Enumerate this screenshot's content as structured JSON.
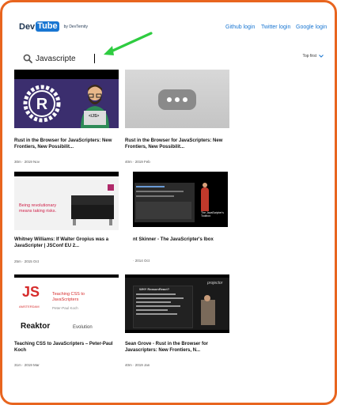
{
  "header": {
    "logo_dev": "Dev",
    "logo_tube": "Tube",
    "logo_by": "by DevTernity",
    "links": [
      "Github login",
      "Twitter login",
      "Google login"
    ]
  },
  "search": {
    "value": "Javascripte",
    "sort_label": "Top first"
  },
  "videos": [
    {
      "title": "Rust in the Browser for JavaScripters: New Frontiers, New Possibilit...",
      "meta": "30m · 2019 Nov",
      "thumb_text": "</JS>"
    },
    {
      "title": "Rust in the Browser for JavaScripters: New Frontiers, New Possibilit...",
      "meta": "40m · 2019 Feb"
    },
    {
      "title": "Whitney Williams: If Walter Gropius was a JavaScripter | JSConf EU 2...",
      "meta": "25m · 2015 Oct",
      "thumb_text": "Being revolutionary means taking risks."
    },
    {
      "title": "nt Skinner - The JavaScripter's lbox",
      "meta": "· 2014 Oct",
      "thumb_text": "The JavaScripter's Toolbox"
    },
    {
      "title": "Teaching CSS to JavaScripters – Peter-Paul Koch",
      "meta": "31m · 2019 Mar",
      "thumb_text_1": "Teaching CSS to JavaScripters",
      "thumb_text_2": "Peter-Paul Koch",
      "thumb_logo": "JS",
      "thumb_city": "AMSTERDAM",
      "thumb_sponsor": "Reaktor",
      "thumb_evo": "Evolution"
    },
    {
      "title": "Sean Grove - Rust in the Browser for Javascripters: New Frontiers, N...",
      "meta": "40m · 2019 Jan",
      "thumb_text": "WHY ReasonReact?",
      "thumb_brand": "projector"
    }
  ]
}
